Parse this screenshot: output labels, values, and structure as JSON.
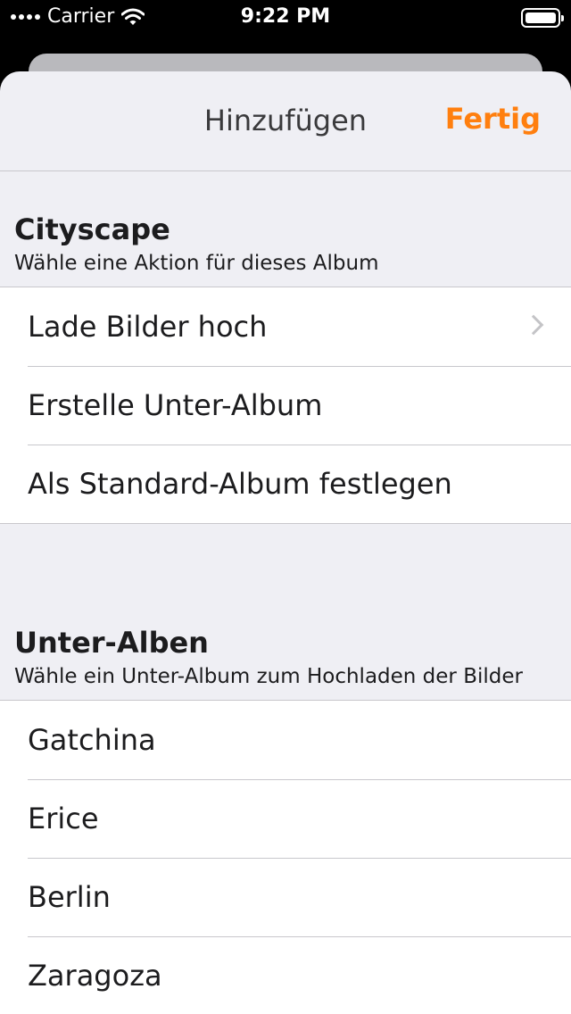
{
  "status_bar": {
    "carrier": "Carrier",
    "time": "9:22 PM"
  },
  "nav": {
    "title": "Hinzufügen",
    "done": "Fertig"
  },
  "section_album": {
    "title": "Cityscape",
    "subtitle": "Wähle eine Aktion für dieses Album",
    "items": [
      {
        "label": "Lade Bilder hoch"
      },
      {
        "label": "Erstelle Unter-Album"
      },
      {
        "label": "Als Standard-Album festlegen"
      }
    ]
  },
  "section_subalbums": {
    "title": "Unter-Alben",
    "subtitle": "Wähle ein Unter-Album zum Hochladen der Bilder",
    "items": [
      {
        "label": "Gatchina"
      },
      {
        "label": "Erice"
      },
      {
        "label": "Berlin"
      },
      {
        "label": "Zaragoza"
      }
    ]
  },
  "colors": {
    "accent": "#ff7f0f",
    "background": "#efeff4"
  }
}
